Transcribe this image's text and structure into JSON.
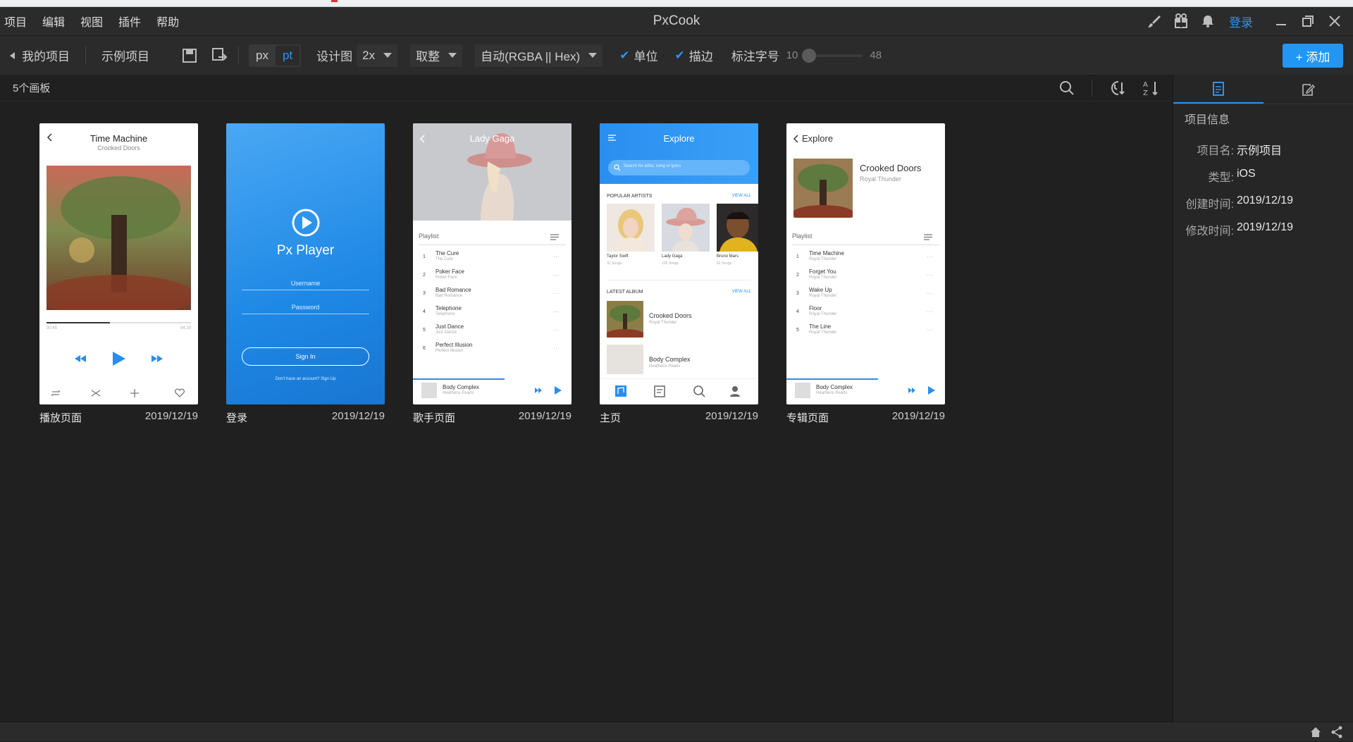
{
  "app": {
    "title": "PxCook"
  },
  "menu": [
    "项目",
    "编辑",
    "视图",
    "插件",
    "帮助"
  ],
  "titlebar": {
    "login_label": "登录"
  },
  "toolbar": {
    "back_label": "我的项目",
    "project_label": "示例项目",
    "unit_px": "px",
    "unit_pt": "pt",
    "design_label": "设计图",
    "scale_value": "2x",
    "rounding_value": "取整",
    "color_format_value": "自动(RGBA || Hex)",
    "unit_check_label": "单位",
    "stroke_check_label": "描边",
    "font_label": "标注字号",
    "font_min": "10",
    "font_max": "48",
    "font_level": 0.0,
    "add_label": "+ 添加"
  },
  "board_header": {
    "count": "5个画板"
  },
  "boards": [
    {
      "name": "播放页面",
      "date": "2019/12/19"
    },
    {
      "name": "登录",
      "date": "2019/12/19"
    },
    {
      "name": "歌手页面",
      "date": "2019/12/19"
    },
    {
      "name": "主页",
      "date": "2019/12/19"
    },
    {
      "name": "专辑页面",
      "date": "2019/12/19"
    }
  ],
  "mocks": {
    "player": {
      "title": "Time Machine",
      "subtitle": "Crooked Doors",
      "elapsed": "00:45",
      "total": "04:20",
      "progress": 0.44
    },
    "login": {
      "brand": "Px Player",
      "username": "Username",
      "password": "Password",
      "signin": "Sign In",
      "signup": "Don't have an account? Sign Up"
    },
    "artist": {
      "title": "Lady Gaga",
      "playlist": "Playlist",
      "tracks": [
        {
          "n": "1",
          "t": "The Cure",
          "s": "The Cure"
        },
        {
          "n": "2",
          "t": "Poker Face",
          "s": "Poker Face"
        },
        {
          "n": "3",
          "t": "Bad Romance",
          "s": "Bad Romance"
        },
        {
          "n": "4",
          "t": "Telephone",
          "s": "Telephone"
        },
        {
          "n": "5",
          "t": "Just Dance",
          "s": "Just Dance"
        },
        {
          "n": "6",
          "t": "Perfect Illusion",
          "s": "Perfect Illusion"
        }
      ],
      "now_playing": "Body Complex",
      "now_artist": "Heathens Pearls"
    },
    "home": {
      "title": "Explore",
      "search": "Search for artist, song or lyrics",
      "popular": "POPULAR ARTISTS",
      "view_all": "VIEW ALL",
      "artists": [
        {
          "name": "Taylor Swift",
          "songs": "32 Songs"
        },
        {
          "name": "Lady Gaga",
          "songs": "126 Songs"
        },
        {
          "name": "Bruno Mars",
          "songs": "62 Songs"
        }
      ],
      "latest": "LATEST ALBUM",
      "albums": [
        {
          "name": "Crooked Doors",
          "artist": "Royal Thunder"
        },
        {
          "name": "Body Complex",
          "artist": "Heathens Pearls"
        }
      ]
    },
    "album": {
      "back": "Explore",
      "album": "Crooked Doors",
      "artist": "Royal Thunder",
      "playlist": "Playlist",
      "tracks": [
        {
          "n": "1",
          "t": "Time Machine",
          "s": "Royal Thunder"
        },
        {
          "n": "2",
          "t": "Forget You",
          "s": "Royal Thunder"
        },
        {
          "n": "3",
          "t": "Wake Up",
          "s": "Royal Thunder"
        },
        {
          "n": "4",
          "t": "Floor",
          "s": "Royal Thunder"
        },
        {
          "n": "5",
          "t": "The Line",
          "s": "Royal Thunder"
        }
      ],
      "now_playing": "Body Complex",
      "now_artist": "Heathens Pearls"
    }
  },
  "right_panel": {
    "section": "项目信息",
    "rows": [
      {
        "k": "项目名:",
        "v": "示例项目"
      },
      {
        "k": "类型:",
        "v": "iOS"
      },
      {
        "k": "创建时间:",
        "v": "2019/12/19"
      },
      {
        "k": "修改时间:",
        "v": "2019/12/19"
      }
    ]
  },
  "colors": {
    "accent": "#2196f3",
    "bg": "#202020",
    "bar": "#2b2b2b"
  }
}
